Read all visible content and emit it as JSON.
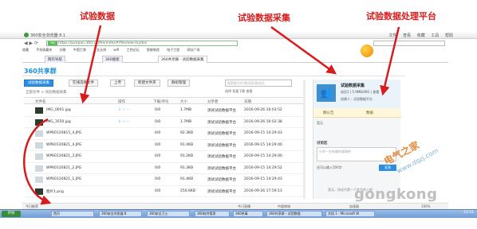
{
  "annotations": {
    "data_label": "试验数据",
    "collection_label": "试验数据采集",
    "platform_label": "试验数据处理平台"
  },
  "browser": {
    "title": "360安全浏览器 8.1",
    "window_controls": [
      "文件",
      "查看",
      "收藏",
      "工具",
      "帮助"
    ],
    "url_badge": "360",
    "url": "https://yunpan.360.cn/file/index#/fileview-mydoc",
    "bookmarks": [
      "收藏",
      "手机收藏夹",
      "谷歌",
      "中国工商",
      "工业无线",
      "wifi",
      "工控论坛",
      "智能制造",
      "电子工程",
      "网址广场"
    ],
    "tabs": [
      "网页导航",
      "360搜索",
      "360共享群 - 试验数据采集"
    ]
  },
  "app": {
    "brand": "360共享群",
    "toolbar": {
      "upload_label": "试验数据采集",
      "select_label": "在线选择文件",
      "upload2_label": "上传",
      "newfolder_label": "新建文件夹",
      "manage_label": "群组管理"
    },
    "search_placeholder": "搜索群文件/群消息/群成员",
    "breadcrumb": "全部文件 > 试验数据采集",
    "sub_options": "选择   批量下载   查看",
    "columns": [
      "文件名",
      "操作",
      "下载/评论",
      "大小",
      "分享者",
      "日期"
    ],
    "rows": [
      {
        "name": "IMG_0001.jpg",
        "dl": "0/0",
        "size": "1.7MB",
        "by": "测试试验数据平台",
        "date": "2016-09-26 16:03:52",
        "thumb": "dark"
      },
      {
        "name": "IMG_3550.jpg",
        "dl": "0/0",
        "size": "1.7MB",
        "by": "测试试验数据平台",
        "date": "2016-09-26 16:02:38",
        "thumb": "dark"
      },
      {
        "name": "WP60120815_4.JPG",
        "dl": "0/0",
        "size": "92.3KB",
        "by": "测试试验数据平台",
        "date": "2016-09-15 14:29:43",
        "thumb": "light"
      },
      {
        "name": "WP60120821_4.JPG",
        "dl": "0/0",
        "size": "91.4KB",
        "by": "测试试验数据平台",
        "date": "2016-09-15 14:29:40",
        "thumb": "light"
      },
      {
        "name": "WP60120821_3.JPG",
        "dl": "0/0",
        "size": "91.2KB",
        "by": "测试试验数据平台",
        "date": "2016-09-15 14:29:40",
        "thumb": "light"
      },
      {
        "name": "WP60120821_2.JPG",
        "dl": "0/0",
        "size": "91.3KB",
        "by": "测试试验数据平台",
        "date": "2016-09-15 14:29:52",
        "thumb": "light"
      },
      {
        "name": "WP60120821_1.JPG",
        "dl": "0/0",
        "size": "91.4KB",
        "by": "测试试验数据平台",
        "date": "2016-09-15 14:29:43",
        "thumb": "light"
      },
      {
        "name": "图片1.png",
        "dl": "0/0",
        "size": "250.6KB",
        "by": "测试试验数据平台",
        "date": "2016-09-26 17:59:13",
        "thumb": "dark"
      }
    ]
  },
  "panel": {
    "name": "试验数据采集",
    "meta": "成员1 | 5.9MB/40G | 查看",
    "owner": "创建人：试验数据平台",
    "btn_quiet": "静公告",
    "btn_data": "数据",
    "intro": "暂无",
    "discussion": "讨论区",
    "input_placeholder": "分享一些有趣的事情吧",
    "recent": "还可以输入500字",
    "send": "发表",
    "no_messages": "暂无，快成为第一个发言的人吧"
  },
  "status": {
    "left": "今日推荐",
    "mid1": "今日直播",
    "mid2": "中超商城",
    "right": "加速器",
    "zoom": "100%"
  },
  "taskbar": {
    "start": "开始",
    "tasks": [
      "首页",
      "360安全浏览器 8",
      "360安全卫士",
      "360软件管家",
      "360杀毒",
      "360共享群 - 试验数据",
      "文档 1 - Microsoft W"
    ],
    "clock": "15:51"
  },
  "watermarks": {
    "cn": "电气之家",
    "url": "www.dqzj.com",
    "gk": "gongkong"
  }
}
